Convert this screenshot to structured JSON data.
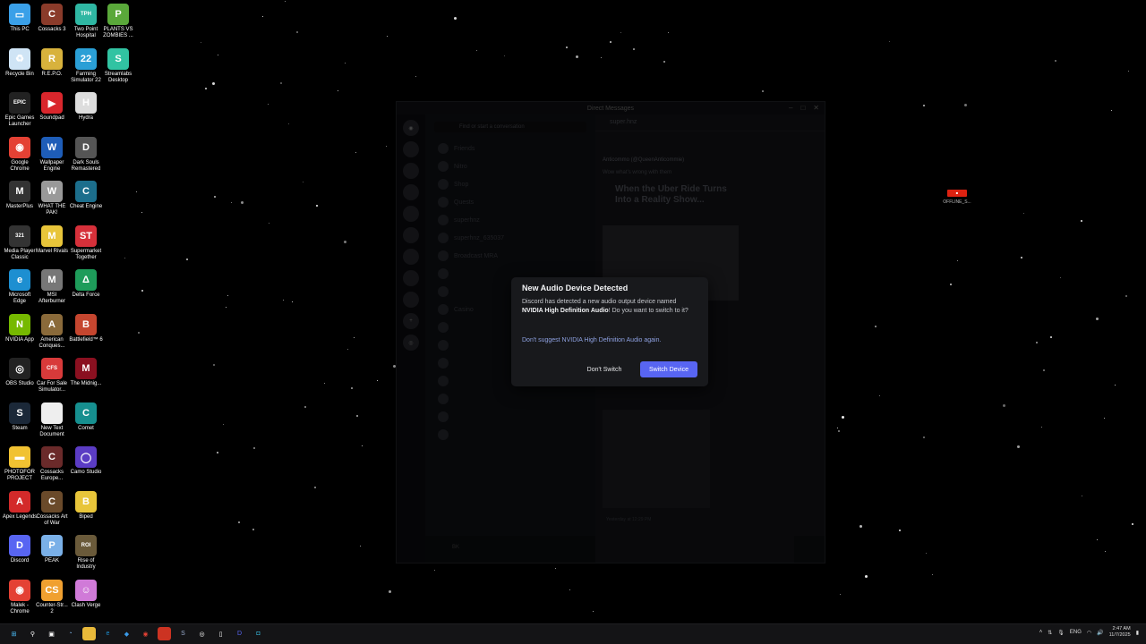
{
  "desktop_icons": [
    {
      "label": "This PC",
      "color": "#3aa0e8",
      "glyph": "▭",
      "icon": "computer-icon"
    },
    {
      "label": "Cossacks 3",
      "color": "#8a3b2a",
      "glyph": "C",
      "icon": "cossacks3-icon"
    },
    {
      "label": "Two Point Hospital",
      "color": "#2fb7a3",
      "glyph": "TPH",
      "icon": "two-point-hospital-icon"
    },
    {
      "label": "PLANTS VS ZOMBIES ...",
      "color": "#5aa83a",
      "glyph": "P",
      "icon": "pvz-icon"
    },
    {
      "label": "Recycle Bin",
      "color": "#cfe4f5",
      "glyph": "♻",
      "icon": "recycle-bin-icon"
    },
    {
      "label": "R.E.P.O.",
      "color": "#d8b23c",
      "glyph": "R",
      "icon": "repo-icon"
    },
    {
      "label": "Farming Simulator 22",
      "color": "#2a9fd6",
      "glyph": "22",
      "icon": "farming-sim-icon"
    },
    {
      "label": "Streamlabs Desktop",
      "color": "#31c3a2",
      "glyph": "S",
      "icon": "streamlabs-icon"
    },
    {
      "label": "Epic Games Launcher",
      "color": "#222",
      "glyph": "EPIC",
      "icon": "epic-games-icon"
    },
    {
      "label": "Soundpad",
      "color": "#d9262c",
      "glyph": "▶",
      "icon": "soundpad-icon"
    },
    {
      "label": "Hydra",
      "color": "#ddd",
      "glyph": "H",
      "icon": "hydra-icon"
    },
    {
      "label": "Google Chrome",
      "color": "#e44134",
      "glyph": "◉",
      "icon": "chrome-icon"
    },
    {
      "label": "Wallpaper Engine",
      "color": "#1e5db8",
      "glyph": "W",
      "icon": "wallpaper-engine-icon"
    },
    {
      "label": "Dark Souls Remastered",
      "color": "#555",
      "glyph": "D",
      "icon": "dark-souls-icon"
    },
    {
      "label": "MasterPlus",
      "color": "#333",
      "glyph": "M",
      "icon": "masterplus-icon"
    },
    {
      "label": "WHAT THE PAK!",
      "color": "#999",
      "glyph": "W",
      "icon": "what-the-pak-icon"
    },
    {
      "label": "Cheat Engine",
      "color": "#1c6e8c",
      "glyph": "C",
      "icon": "cheat-engine-icon"
    },
    {
      "label": "Media Player Classic",
      "color": "#333",
      "glyph": "321",
      "icon": "mpc-icon"
    },
    {
      "label": "Marvel Rivals",
      "color": "#e8c53a",
      "glyph": "M",
      "icon": "marvel-rivals-icon"
    },
    {
      "label": "Supermarket Together",
      "color": "#d6303a",
      "glyph": "ST",
      "icon": "supermarket-icon"
    },
    {
      "label": "Microsoft Edge",
      "color": "#1d8fd1",
      "glyph": "e",
      "icon": "edge-icon"
    },
    {
      "label": "MSI Afterburner",
      "color": "#777",
      "glyph": "M",
      "icon": "msi-icon"
    },
    {
      "label": "Delta Force",
      "color": "#1e9c5a",
      "glyph": "Δ",
      "icon": "delta-force-icon"
    },
    {
      "label": "NVIDIA App",
      "color": "#76b900",
      "glyph": "N",
      "icon": "nvidia-icon"
    },
    {
      "label": "American Conques...",
      "color": "#8a6a3a",
      "glyph": "A",
      "icon": "american-conquest-icon"
    },
    {
      "label": "Battlefield™ 6",
      "color": "#c5462f",
      "glyph": "B",
      "icon": "battlefield-icon"
    },
    {
      "label": "OBS Studio",
      "color": "#222",
      "glyph": "◎",
      "icon": "obs-icon"
    },
    {
      "label": "Car For Sale Simulator...",
      "color": "#d83a3a",
      "glyph": "CFS",
      "icon": "car-for-sale-icon"
    },
    {
      "label": "The Midnig...",
      "color": "#8a1020",
      "glyph": "M",
      "icon": "midnight-icon"
    },
    {
      "label": "Steam",
      "color": "#1b2838",
      "glyph": "S",
      "icon": "steam-icon"
    },
    {
      "label": "New Text Document",
      "color": "#eee",
      "glyph": "",
      "icon": "text-document-icon"
    },
    {
      "label": "Comet",
      "color": "#168f8f",
      "glyph": "C",
      "icon": "comet-icon"
    },
    {
      "label": "PHOTOFOR PROJECT",
      "color": "#f1c232",
      "glyph": "▬",
      "icon": "folder-icon"
    },
    {
      "label": "Cossacks Europe...",
      "color": "#6a2a2a",
      "glyph": "C",
      "icon": "cossacks-europe-icon"
    },
    {
      "label": "Camo Studio",
      "color": "#5b3cc4",
      "glyph": "◯",
      "icon": "camo-studio-icon"
    },
    {
      "label": "Apex Legends",
      "color": "#d32a2a",
      "glyph": "A",
      "icon": "apex-icon"
    },
    {
      "label": "Cossacks Art of War",
      "color": "#6a4a2a",
      "glyph": "C",
      "icon": "cossacks-art-icon"
    },
    {
      "label": "Biped",
      "color": "#e8c53a",
      "glyph": "B",
      "icon": "biped-icon"
    },
    {
      "label": "Discord",
      "color": "#5865f2",
      "glyph": "D",
      "icon": "discord-icon"
    },
    {
      "label": "PEAK",
      "color": "#7ab0e8",
      "glyph": "P",
      "icon": "peak-icon"
    },
    {
      "label": "Rise of Industry",
      "color": "#6a5a3a",
      "glyph": "ROI",
      "icon": "rise-of-industry-icon"
    },
    {
      "label": "Malek - Chrome",
      "color": "#e44134",
      "glyph": "◉",
      "icon": "chrome-profile-icon"
    },
    {
      "label": "Counter-Str... 2",
      "color": "#f0a030",
      "glyph": "CS",
      "icon": "cs2-icon"
    },
    {
      "label": "Clash Verge",
      "color": "#d07ad8",
      "glyph": "☺",
      "icon": "clash-verge-icon"
    }
  ],
  "discord": {
    "window_title": "Direct Messages",
    "search_placeholder": "Find or start a conversation",
    "chat_channel": "super.hnz",
    "post_author": "Anticommo (@QueenAnticommie)",
    "post_sub": "Wow what's wrong with them",
    "post_title": "When the Uber Ride Turns Into a Reality Show...",
    "post_time": "Yesterday at 12:29 PM",
    "dm_items": [
      "Friends",
      "Nitro",
      "Shop",
      "Quests",
      "superhnz",
      "superhnz_635037",
      "Broadcast MRA",
      "",
      "",
      "Casino",
      "",
      "",
      "",
      "",
      "",
      "",
      ""
    ],
    "user_name": "BK"
  },
  "modal": {
    "title": "New Audio Device Detected",
    "body_prefix": "Discord has detected a new audio output device named ",
    "device": "NVIDIA High Definition Audio",
    "body_suffix": "! Do you want to switch to it?",
    "link": "Don't suggest NVIDIA High Definition Audio again.",
    "cancel": "Don't Switch",
    "confirm": "Switch Device",
    "confirm_color": "#5865f2"
  },
  "offline_label": "OFFLINE_S...",
  "taskbar": {
    "lang": "ENG",
    "time": "2:47 AM",
    "date": "11/7/2025"
  }
}
